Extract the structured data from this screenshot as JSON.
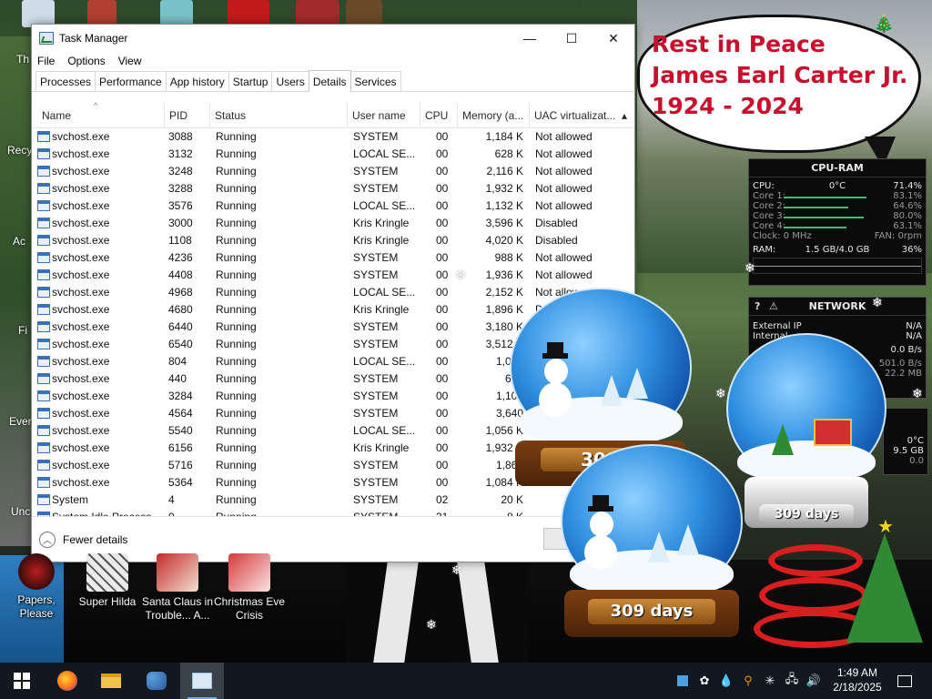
{
  "window": {
    "title": "Task Manager",
    "controls": {
      "minimize": "—",
      "maximize": "☐",
      "close": "✕"
    }
  },
  "menu": [
    "File",
    "Options",
    "View"
  ],
  "tabs": [
    "Processes",
    "Performance",
    "App history",
    "Startup",
    "Users",
    "Details",
    "Services"
  ],
  "active_tab": "Details",
  "columns": [
    "Name",
    "PID",
    "Status",
    "User name",
    "CPU",
    "Memory (a...",
    "UAC virtualizat..."
  ],
  "rows": [
    [
      "svchost.exe",
      "3088",
      "Running",
      "SYSTEM",
      "00",
      "1,184 K",
      "Not allowed"
    ],
    [
      "svchost.exe",
      "3132",
      "Running",
      "LOCAL SE...",
      "00",
      "628 K",
      "Not allowed"
    ],
    [
      "svchost.exe",
      "3248",
      "Running",
      "SYSTEM",
      "00",
      "2,116 K",
      "Not allowed"
    ],
    [
      "svchost.exe",
      "3288",
      "Running",
      "SYSTEM",
      "00",
      "1,932 K",
      "Not allowed"
    ],
    [
      "svchost.exe",
      "3576",
      "Running",
      "LOCAL SE...",
      "00",
      "1,132 K",
      "Not allowed"
    ],
    [
      "svchost.exe",
      "3000",
      "Running",
      "Kris Kringle",
      "00",
      "3,596 K",
      "Disabled"
    ],
    [
      "svchost.exe",
      "1108",
      "Running",
      "Kris Kringle",
      "00",
      "4,020 K",
      "Disabled"
    ],
    [
      "svchost.exe",
      "4236",
      "Running",
      "SYSTEM",
      "00",
      "988 K",
      "Not allowed"
    ],
    [
      "svchost.exe",
      "4408",
      "Running",
      "SYSTEM",
      "00",
      "1,936 K",
      "Not allowed"
    ],
    [
      "svchost.exe",
      "4968",
      "Running",
      "LOCAL SE...",
      "00",
      "2,152 K",
      "Not allowed"
    ],
    [
      "svchost.exe",
      "4680",
      "Running",
      "Kris Kringle",
      "00",
      "1,896 K",
      "Di"
    ],
    [
      "svchost.exe",
      "6440",
      "Running",
      "SYSTEM",
      "00",
      "3,180 K",
      ""
    ],
    [
      "svchost.exe",
      "6540",
      "Running",
      "SYSTEM",
      "00",
      "3,512 K",
      ""
    ],
    [
      "svchost.exe",
      "804",
      "Running",
      "LOCAL SE...",
      "00",
      "1,028",
      ""
    ],
    [
      "svchost.exe",
      "440",
      "Running",
      "SYSTEM",
      "00",
      "664",
      ""
    ],
    [
      "svchost.exe",
      "3284",
      "Running",
      "SYSTEM",
      "00",
      "1,100",
      ""
    ],
    [
      "svchost.exe",
      "4564",
      "Running",
      "SYSTEM",
      "00",
      "3,640",
      ""
    ],
    [
      "svchost.exe",
      "5540",
      "Running",
      "LOCAL SE...",
      "00",
      "1,056 K",
      ""
    ],
    [
      "svchost.exe",
      "6156",
      "Running",
      "Kris Kringle",
      "00",
      "1,932 K",
      ""
    ],
    [
      "svchost.exe",
      "5716",
      "Running",
      "SYSTEM",
      "00",
      "1,868",
      ""
    ],
    [
      "svchost.exe",
      "5364",
      "Running",
      "SYSTEM",
      "00",
      "1,084 K",
      "No"
    ],
    [
      "System",
      "4",
      "Running",
      "SYSTEM",
      "02",
      "20 K",
      ""
    ],
    [
      "System Idle Process",
      "0",
      "Running",
      "SYSTEM",
      "31",
      "8 K",
      ""
    ]
  ],
  "footer": {
    "fewer_details": "Fewer details"
  },
  "bubble_text": [
    "Rest in Peace",
    "James Earl Carter Jr.",
    "1924 - 2024"
  ],
  "cpu_gadget": {
    "title": "CPU-RAM",
    "cpu_label": "CPU:",
    "cpu_temp": "0°C",
    "cpu_pct": "71.4%",
    "cpu_level": 0.714,
    "cores": [
      {
        "label": "Core 1:",
        "value": "83.1%",
        "level": 0.831
      },
      {
        "label": "Core 2:",
        "value": "64.6%",
        "level": 0.646
      },
      {
        "label": "Core 3:",
        "value": "80.0%",
        "level": 0.8
      },
      {
        "label": "Core 4:",
        "value": "63.1%",
        "level": 0.631
      }
    ],
    "clock_label": "Clock: 0 MHz",
    "fan_label": "FAN: 0rpm",
    "ram_label": "RAM:",
    "ram_value": "1.5 GB/4.0 GB",
    "ram_pct": "36%"
  },
  "network_gadget": {
    "title": "NETWORK",
    "rows": [
      {
        "label": "External IP",
        "value": "N/A"
      },
      {
        "label": "Internal",
        "value": "N/A"
      },
      {
        "label": "",
        "value": "0.0 B/s"
      },
      {
        "label": "",
        "value": "501.0 B/s"
      },
      {
        "label": "",
        "value": "22.2 MB"
      }
    ]
  },
  "third_gadget": {
    "temp": "0°C",
    "size": "9.5 GB",
    "value": "0.0"
  },
  "globes": [
    {
      "days_label": "309"
    },
    {
      "days_label": "309 days"
    },
    {
      "days_label": "309 days"
    }
  ],
  "desktop_icons": [
    {
      "label": "Papers, Please"
    },
    {
      "label": "Super Hilda"
    },
    {
      "label": "Santa Claus in Trouble... A..."
    },
    {
      "label": "Christmas Eve Crisis"
    }
  ],
  "partial_labels": [
    "Th",
    "Recy",
    "Ac",
    "Fi",
    "Ever",
    "Unc"
  ],
  "taskbar": {
    "clock_time": "1:49 AM",
    "clock_date": "2/18/2025"
  },
  "icons": [
    "windows-logo-icon",
    "firefox-icon",
    "file-explorer-icon",
    "people-icon",
    "task-manager-icon",
    "notification-icon"
  ],
  "colors": {
    "bubble_text": "#c8102e",
    "taskbar": "#111820",
    "accent": "#7aa7d8"
  }
}
